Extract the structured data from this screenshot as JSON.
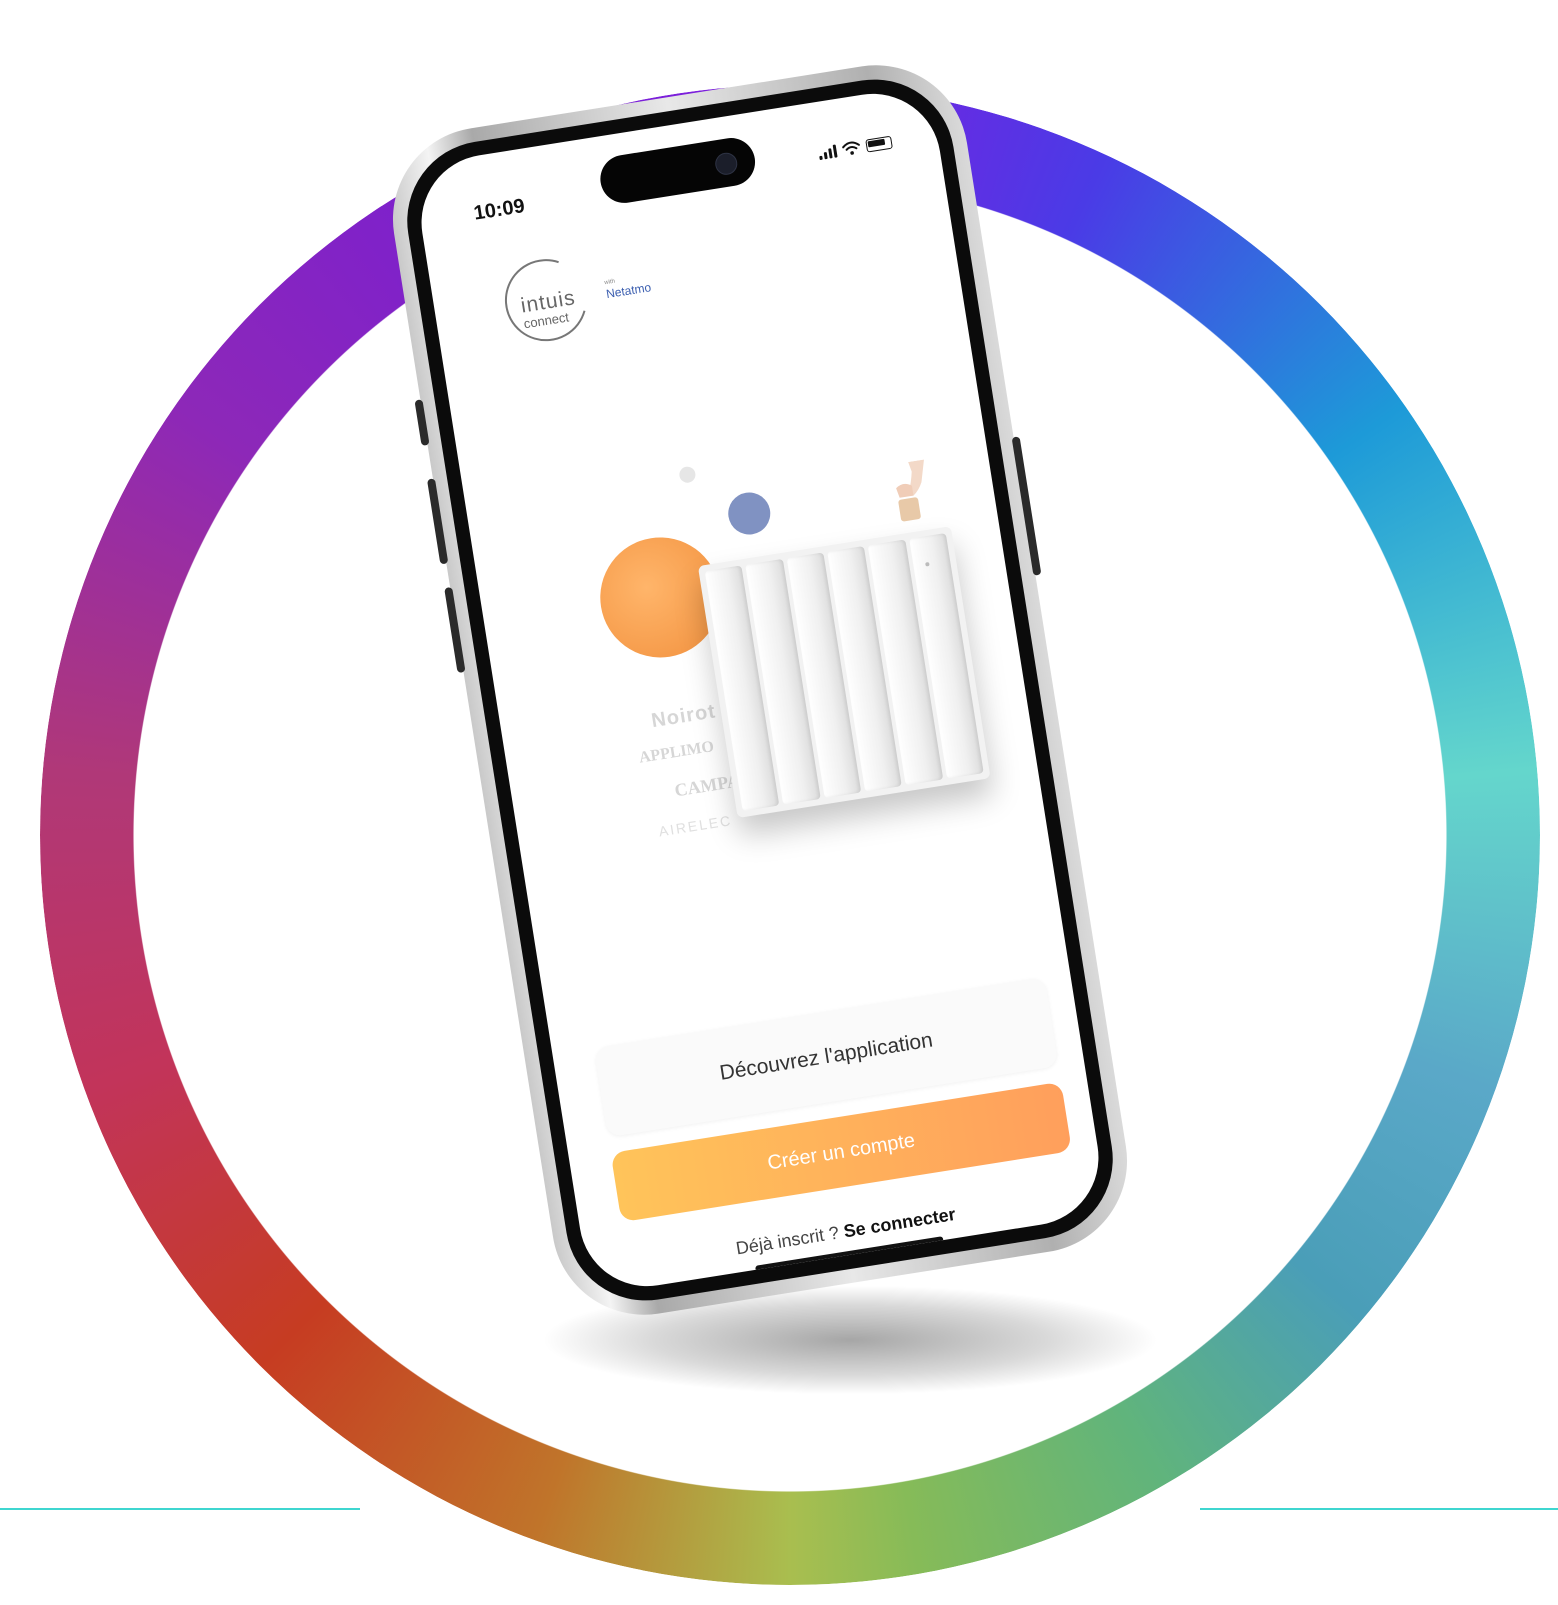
{
  "colors": {
    "accent_orange_start": "#ffc45a",
    "accent_orange_end": "#ff9f5c",
    "brand_blue": "#3c5fb0",
    "divider_cyan": "#3fd6d0"
  },
  "status_bar": {
    "time": "10:09",
    "icons": [
      "signal-icon",
      "wifi-icon",
      "battery-icon"
    ]
  },
  "logo": {
    "name_line1": "intuis",
    "name_line2": "connect",
    "partner_prefix": "with",
    "partner": "Netatmo"
  },
  "brands": [
    "Noirot",
    "APPLIMO",
    "CAMPA",
    "AIRELEC"
  ],
  "actions": {
    "discover_label": "Découvrez l'application",
    "create_label": "Créer un compte",
    "login_prompt": "Déjà inscrit ?",
    "login_link": "Se connecter"
  }
}
